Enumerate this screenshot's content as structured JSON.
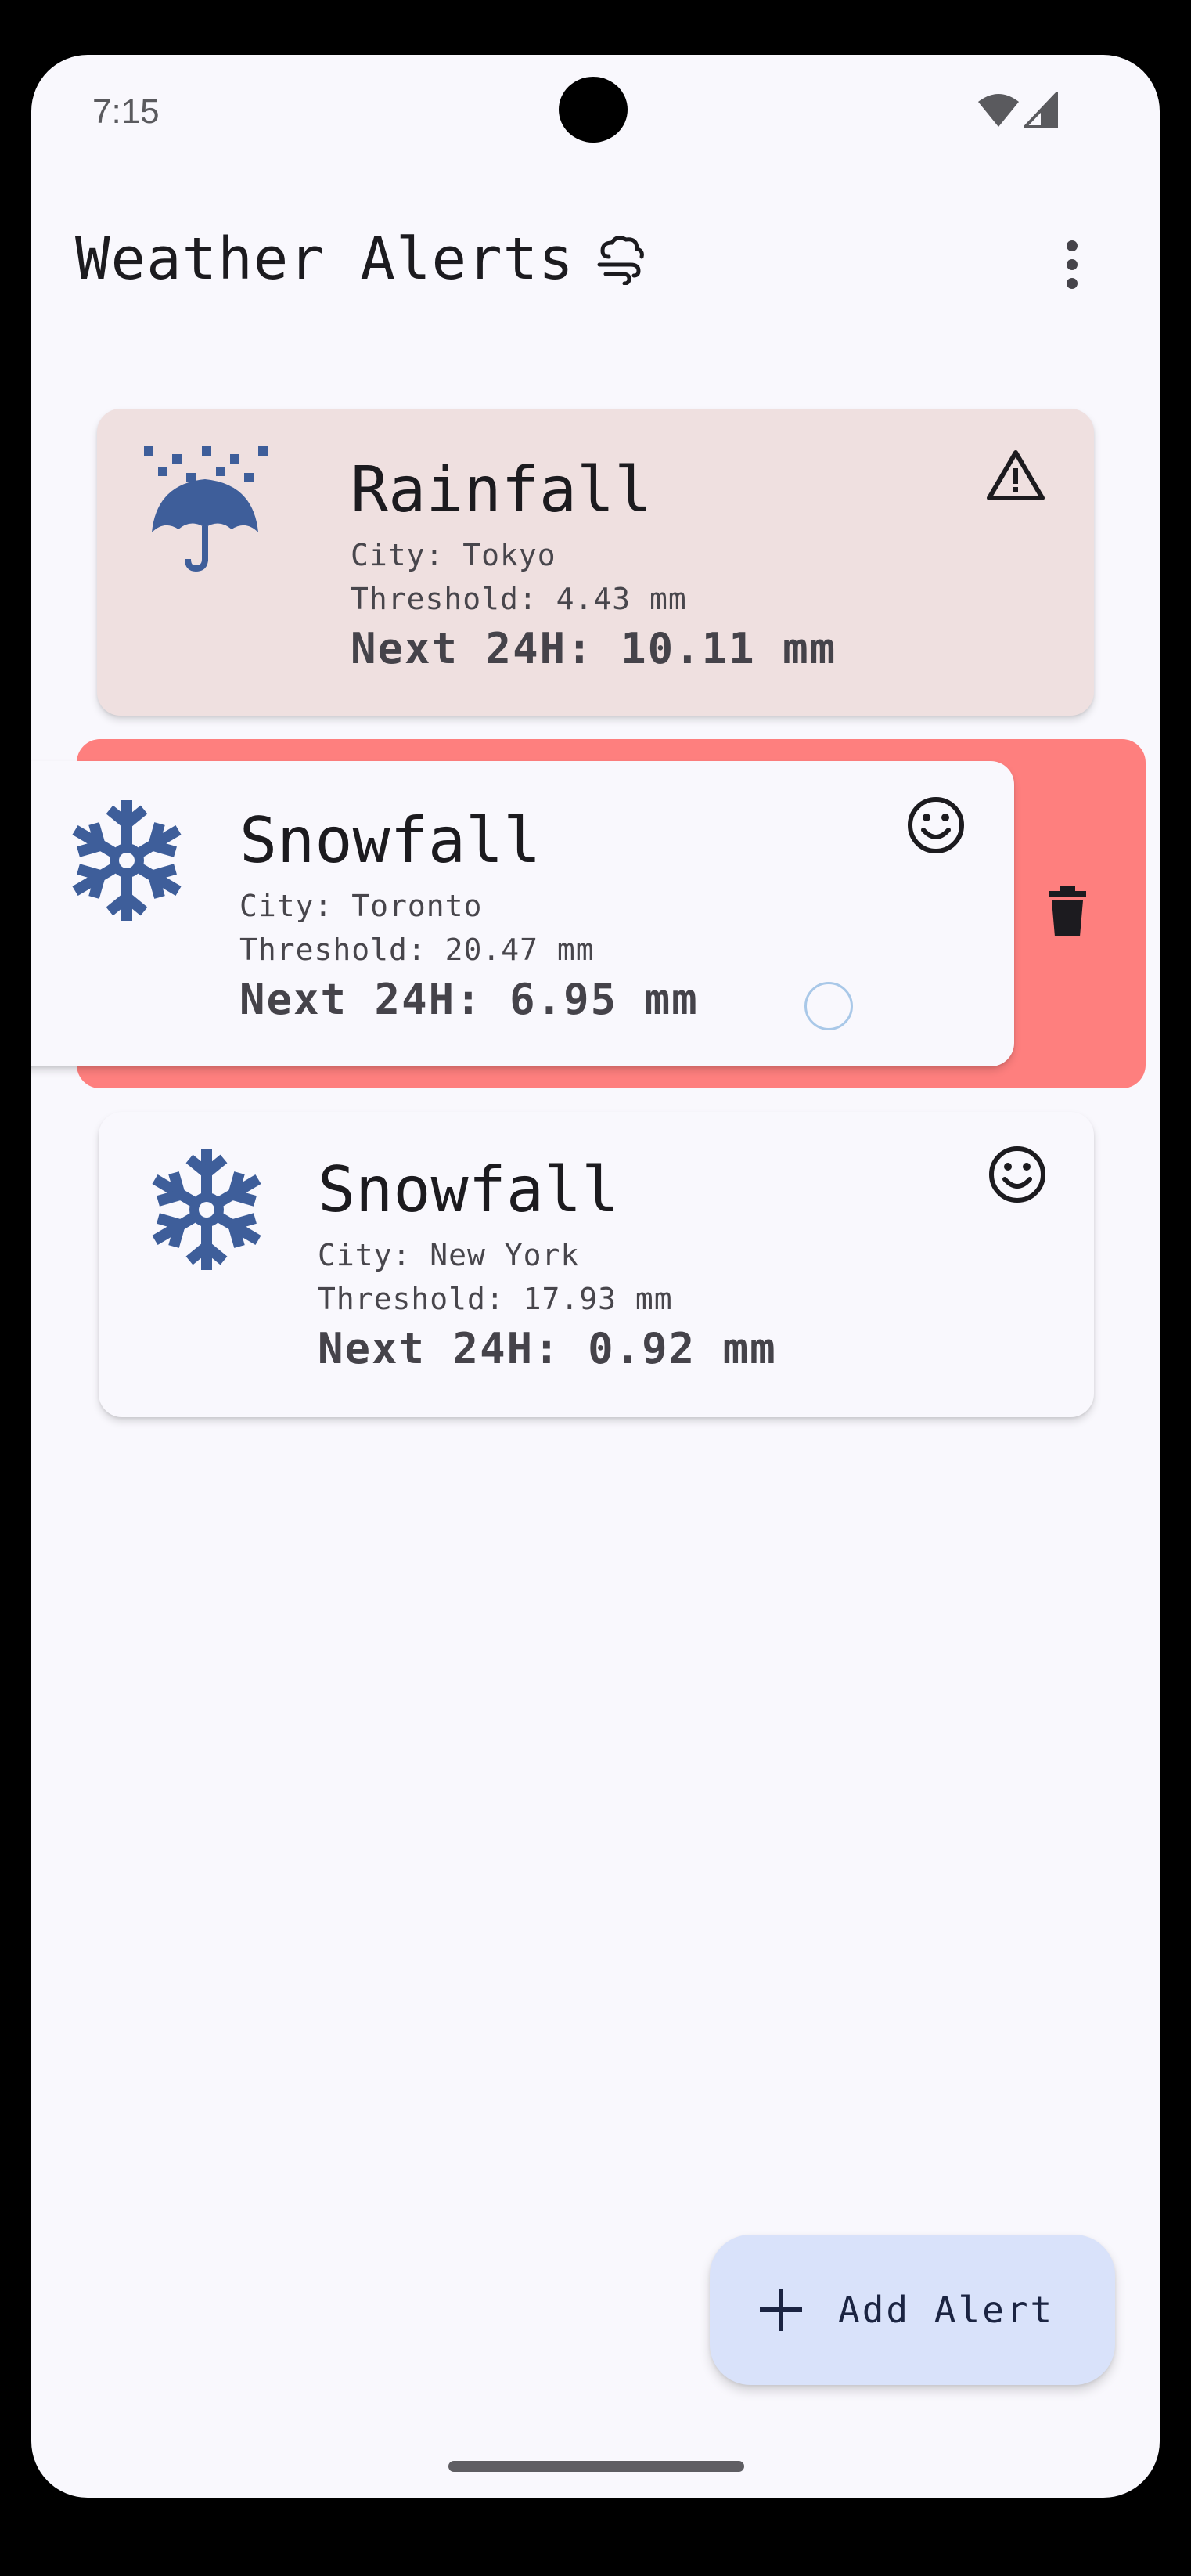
{
  "status_bar": {
    "time": "7:15"
  },
  "app_bar": {
    "title": "Weather Alerts",
    "title_icon": "cloud-wind-icon",
    "menu_icon": "more-vert-icon"
  },
  "alerts": [
    {
      "title": "Rainfall",
      "city": "City: Tokyo",
      "threshold": "Threshold: 4.43 mm",
      "forecast": "Next 24H: 10.11 mm",
      "icon": "umbrella-rain-icon",
      "status_icon": "warning-icon",
      "background": "#efe0e0"
    },
    {
      "title": "Snowfall",
      "city": "City: Toronto",
      "threshold": "Threshold: 20.47 mm",
      "forecast": "Next 24H: 6.95 mm",
      "icon": "snowflake-icon",
      "status_icon": "smile-icon",
      "background": "#f9f8fd"
    },
    {
      "title": "Snowfall",
      "city": "City: New York",
      "threshold": "Threshold: 17.93 mm",
      "forecast": "Next 24H: 0.92 mm",
      "icon": "snowflake-icon",
      "status_icon": "smile-icon",
      "background": "#f9f8fd"
    }
  ],
  "swipe_action": {
    "icon": "trash-icon",
    "color": "#fe7f7e"
  },
  "fab": {
    "label": "Add Alert",
    "icon": "plus-icon",
    "color": "#d9e2fa"
  },
  "colors": {
    "accent_icon": "#3e5e9a",
    "screen_background": "#f9f8fd"
  }
}
